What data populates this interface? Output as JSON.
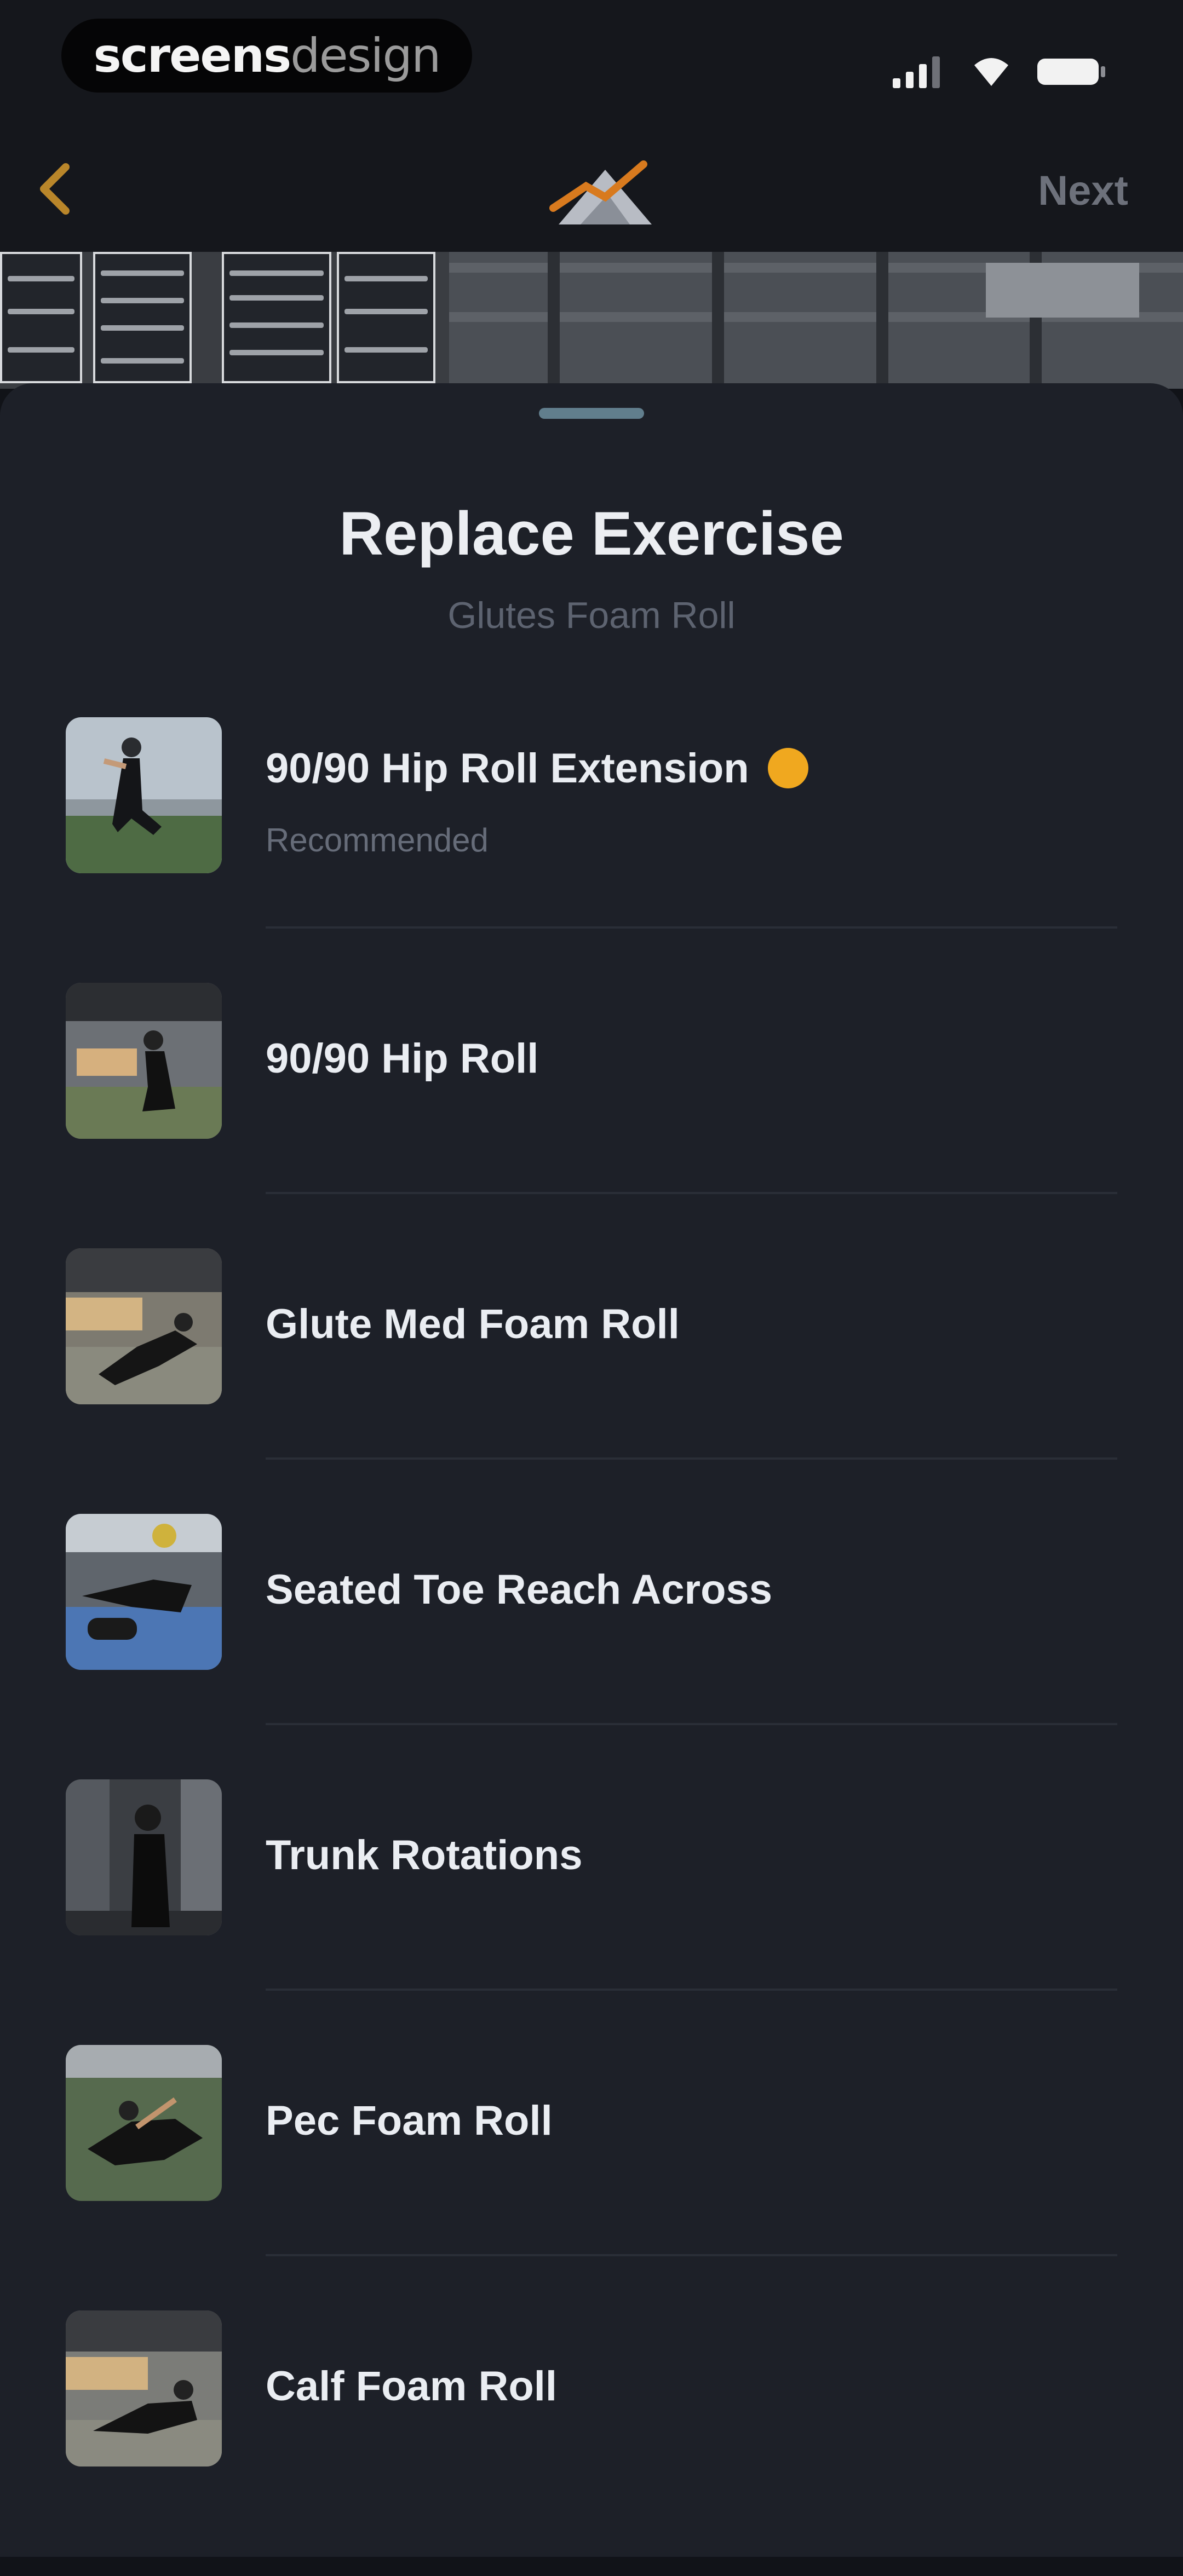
{
  "status_bar": {
    "brand_part1": "screens",
    "brand_part2": "design"
  },
  "nav": {
    "next_label": "Next"
  },
  "sheet": {
    "title": "Replace Exercise",
    "subtitle": "Glutes Foam Roll"
  },
  "exercises": [
    {
      "name": "90/90 Hip Roll Extension",
      "tag": "Recommended",
      "badge_icon": "star-badge-icon"
    },
    {
      "name": "90/90 Hip Roll"
    },
    {
      "name": "Glute Med Foam Roll"
    },
    {
      "name": "Seated Toe Reach Across"
    },
    {
      "name": "Trunk Rotations"
    },
    {
      "name": "Pec Foam Roll"
    },
    {
      "name": "Calf Foam Roll"
    }
  ],
  "colors": {
    "background": "#1d2028",
    "accent": "#d19a2a",
    "badge": "#f0a81f",
    "handle": "#617e8d"
  }
}
